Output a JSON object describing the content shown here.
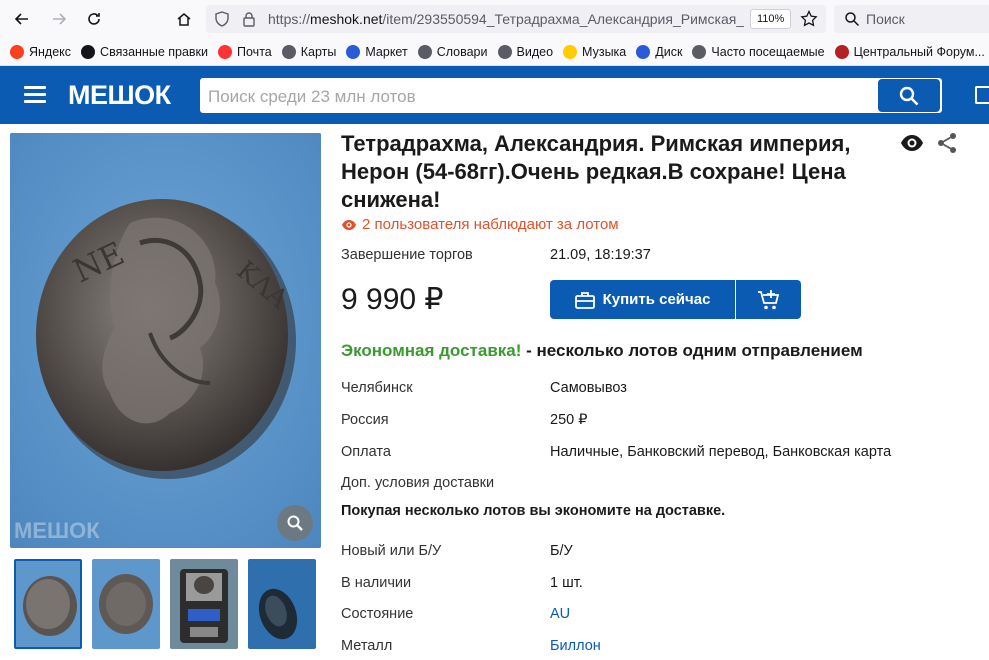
{
  "browser": {
    "url_prefix": "https://",
    "url_host": "meshok.net",
    "url_path": "/item/293550594_Тетрадрахма_Александрия_Римская_и",
    "zoom": "110%",
    "search_label": "Поиск"
  },
  "bookmarks": [
    {
      "label": "Яндекс",
      "icon": "yandex-icon",
      "color": "#fc3f1d"
    },
    {
      "label": "Связанные правки",
      "icon": "wikipedia-icon",
      "color": "#15141a"
    },
    {
      "label": "Почта",
      "icon": "mail-icon",
      "color": "#f33"
    },
    {
      "label": "Карты",
      "icon": "globe-icon",
      "color": "#5b5b66"
    },
    {
      "label": "Маркет",
      "icon": "cart-icon",
      "color": "#2a5bd7"
    },
    {
      "label": "Словари",
      "icon": "globe-icon",
      "color": "#5b5b66"
    },
    {
      "label": "Видео",
      "icon": "globe-icon",
      "color": "#5b5b66"
    },
    {
      "label": "Музыка",
      "icon": "music-icon",
      "color": "#ffcc00"
    },
    {
      "label": "Диск",
      "icon": "disk-icon",
      "color": "#2a5bd7"
    },
    {
      "label": "Часто посещаемые",
      "icon": "gear-icon",
      "color": "#5b5b66"
    },
    {
      "label": "Центральный Форум...",
      "icon": "forum-icon",
      "color": "#b22222"
    }
  ],
  "site": {
    "logo": "МЕШОК",
    "search_placeholder": "Поиск среди 23 млн лотов",
    "brand_color": "#0b5bb3"
  },
  "lot": {
    "title": "Тетрадрахма, Александрия. Римская империя, Нерон (54-68гг).Очень редкая.В сохране! Цена снижена!",
    "watchers": "2 пользователя наблюдают за лотом",
    "end_label": "Завершение торгов",
    "end_value": "21.09, 18:19:37",
    "price": "9 990 ₽",
    "buy_label": "Купить сейчас",
    "delivery_green": "Экономная доставка!",
    "delivery_rest": " - несколько лотов одним отправлением",
    "shipping": [
      {
        "label": "Челябинск",
        "value": "Самовывоз"
      },
      {
        "label": "Россия",
        "value": "250 ₽"
      },
      {
        "label": "Оплата",
        "value": "Наличные, Банковский перевод, Банковская карта"
      },
      {
        "label": "Доп. условия доставки",
        "value": ""
      }
    ],
    "note": "Покупая несколько лотов вы экономите на доставке.",
    "props": [
      {
        "label": "Новый или Б/У",
        "value": "Б/У",
        "link": false
      },
      {
        "label": "В наличии",
        "value": "1 шт.",
        "link": false
      },
      {
        "label": "Состояние",
        "value": "AU",
        "link": true
      },
      {
        "label": "Металл",
        "value": "Биллон",
        "link": true
      }
    ],
    "watermark": "МЕШОК"
  }
}
